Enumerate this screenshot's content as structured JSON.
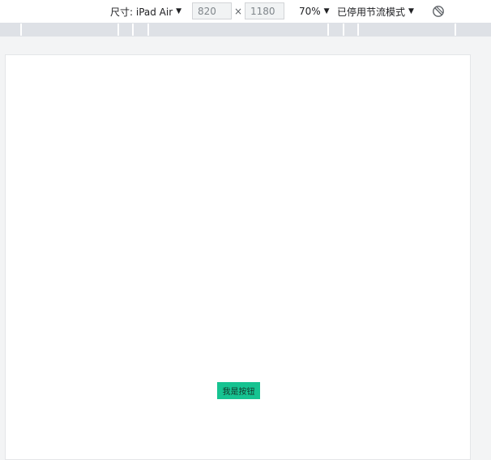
{
  "toolbar": {
    "dimensions_label": "尺寸: iPad Air",
    "width_value": "820",
    "times_sign": "×",
    "height_value": "1180",
    "zoom_label": "70%",
    "throttle_label": "已停用节流模式",
    "caret": "▼"
  },
  "page": {
    "button_label": "我是按钮"
  },
  "colors": {
    "button_bg": "#16c391",
    "ruler_bg": "#dee1e6",
    "viewport_bg": "#f3f4f5"
  }
}
